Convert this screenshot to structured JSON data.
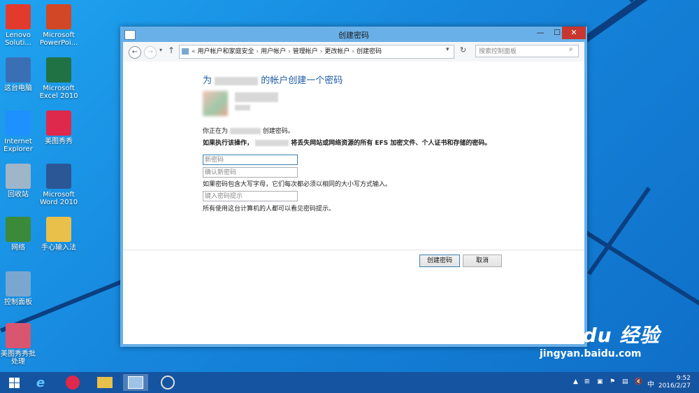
{
  "desktop": {
    "icons": [
      {
        "label": "Lenovo\nSoluti...",
        "icon": "lenovo-icon",
        "color": "#e23b2e"
      },
      {
        "label": "Microsoft\nPowerPoi...",
        "icon": "powerpoint-icon",
        "color": "#d24726"
      },
      {
        "label": "这台电脑",
        "icon": "computer-icon",
        "color": "#3b6fb5"
      },
      {
        "label": "Microsoft\nExcel 2010",
        "icon": "excel-icon",
        "color": "#207245"
      },
      {
        "label": "Internet\nExplorer",
        "icon": "ie-icon",
        "color": "#1e90ff"
      },
      {
        "label": "美图秀秀",
        "icon": "meitu-icon",
        "color": "#e0284c"
      },
      {
        "label": "回收站",
        "icon": "recycle-bin-icon",
        "color": "#9fb6c9"
      },
      {
        "label": "Microsoft\nWord 2010",
        "icon": "word-icon",
        "color": "#2b5797"
      },
      {
        "label": "网络",
        "icon": "network-icon",
        "color": "#3a8a3a"
      },
      {
        "label": "手心输入法",
        "icon": "folder-icon",
        "color": "#e8c04a"
      },
      {
        "label": "控制面板",
        "icon": "control-panel-icon",
        "color": "#7aa7cf"
      },
      {
        "label": "美图秀秀批\n处理",
        "icon": "meitu-batch-icon",
        "color": "#d8566f"
      }
    ]
  },
  "window": {
    "title": "创建密码",
    "min": "—",
    "max": "☐",
    "close": "✕",
    "breadcrumb": [
      "«",
      "用户帐户和家庭安全",
      "›",
      "用户帐户",
      "›",
      "管理帐户",
      "›",
      "更改帐户",
      "›",
      "创建密码"
    ],
    "search_placeholder": "搜索控制面板"
  },
  "content": {
    "heading_prefix": "为",
    "heading_suffix": "的帐户创建一个密码",
    "creating_prefix": "你正在为",
    "creating_suffix": "创建密码。",
    "warning_prefix": "如果执行该操作，",
    "warning_suffix": "将丢失网站或网络资源的所有 EFS 加密文件、个人证书和存储的密码。",
    "new_password_placeholder": "新密码",
    "confirm_password_placeholder": "确认新密码",
    "case_note": "如果密码包含大写字母，它们每次都必须以相同的大小写方式输入。",
    "hint_placeholder": "键入密码提示",
    "hint_note": "所有使用这台计算机的人都可以看见密码提示。",
    "create_button": "创建密码",
    "cancel_button": "取消"
  },
  "taskbar": {
    "clock_time": "9:52",
    "clock_date": "2016/2/27",
    "ime": "中"
  },
  "watermark": {
    "brand": "Bai du 经验",
    "url": "jingyan.baidu.com"
  }
}
